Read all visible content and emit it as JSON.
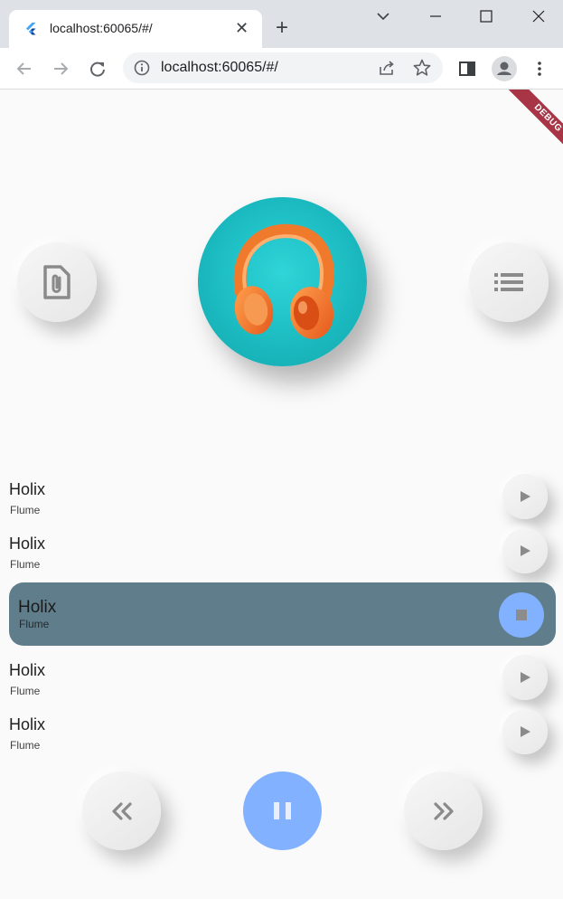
{
  "browser": {
    "tab_title": "localhost:60065/#/",
    "url": "localhost:60065/#/",
    "tab_close": "✕",
    "new_tab": "+"
  },
  "app": {
    "debug_banner": "DEBUG",
    "accent_color": "#82b1ff",
    "active_row_color": "#607d8b",
    "songs": [
      {
        "title": "Holix",
        "artist": "Flume",
        "state": "play"
      },
      {
        "title": "Holix",
        "artist": "Flume",
        "state": "play"
      },
      {
        "title": "Holix",
        "artist": "Flume",
        "state": "playing"
      },
      {
        "title": "Holix",
        "artist": "Flume",
        "state": "play"
      },
      {
        "title": "Holix",
        "artist": "Flume",
        "state": "play"
      }
    ],
    "icons": {
      "left_top": "file-attachment-icon",
      "right_top": "list-icon",
      "cover": "headphones-image",
      "prev": "double-chevron-left-icon",
      "main": "pause-icon",
      "next": "double-chevron-right-icon"
    }
  }
}
